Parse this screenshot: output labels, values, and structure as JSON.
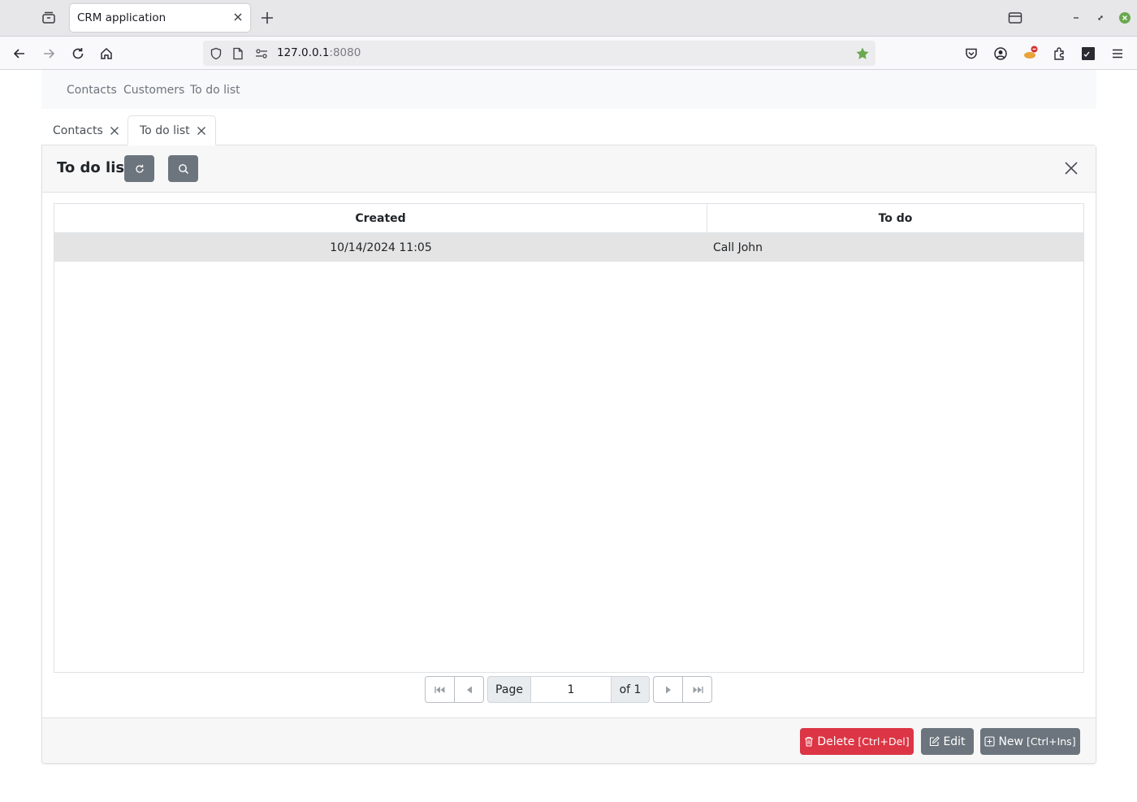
{
  "browser": {
    "tab_title": "CRM application",
    "url_host": "127.0.0.1",
    "url_port": ":8080"
  },
  "app_nav": {
    "items": [
      "Contacts",
      "Customers",
      "To do list"
    ]
  },
  "app_tabs": [
    {
      "label": "Contacts",
      "active": false
    },
    {
      "label": "To do list",
      "active": true
    }
  ],
  "panel": {
    "title": "To do list"
  },
  "grid": {
    "columns": [
      "Created",
      "To do"
    ],
    "rows": [
      {
        "created": "10/14/2024 11:05",
        "todo": "Call John"
      }
    ]
  },
  "pager": {
    "page_label": "Page",
    "page_value": "1",
    "of_label": "of 1"
  },
  "actions": {
    "delete_label": "Delete",
    "delete_shortcut": "[Ctrl+Del]",
    "edit_label": "Edit",
    "new_label": "New",
    "new_shortcut": "[Ctrl+Ins]"
  },
  "colors": {
    "danger": "#dc3545",
    "secondary": "#6c757d",
    "bookmark_star": "#6aa84f"
  },
  "icons": [
    "tab-overview-icon",
    "close-icon",
    "plus-icon",
    "back-icon",
    "forward-icon",
    "reload-icon",
    "home-icon",
    "shield-icon",
    "page-icon",
    "permissions-icon",
    "star-icon",
    "pocket-icon",
    "account-icon",
    "extension-icon",
    "puzzle-icon",
    "selenium-icon",
    "menu-icon",
    "refresh-icon",
    "search-icon",
    "trash-icon",
    "edit-icon",
    "plus-square-icon",
    "first-page-icon",
    "prev-page-icon",
    "next-page-icon",
    "last-page-icon"
  ]
}
